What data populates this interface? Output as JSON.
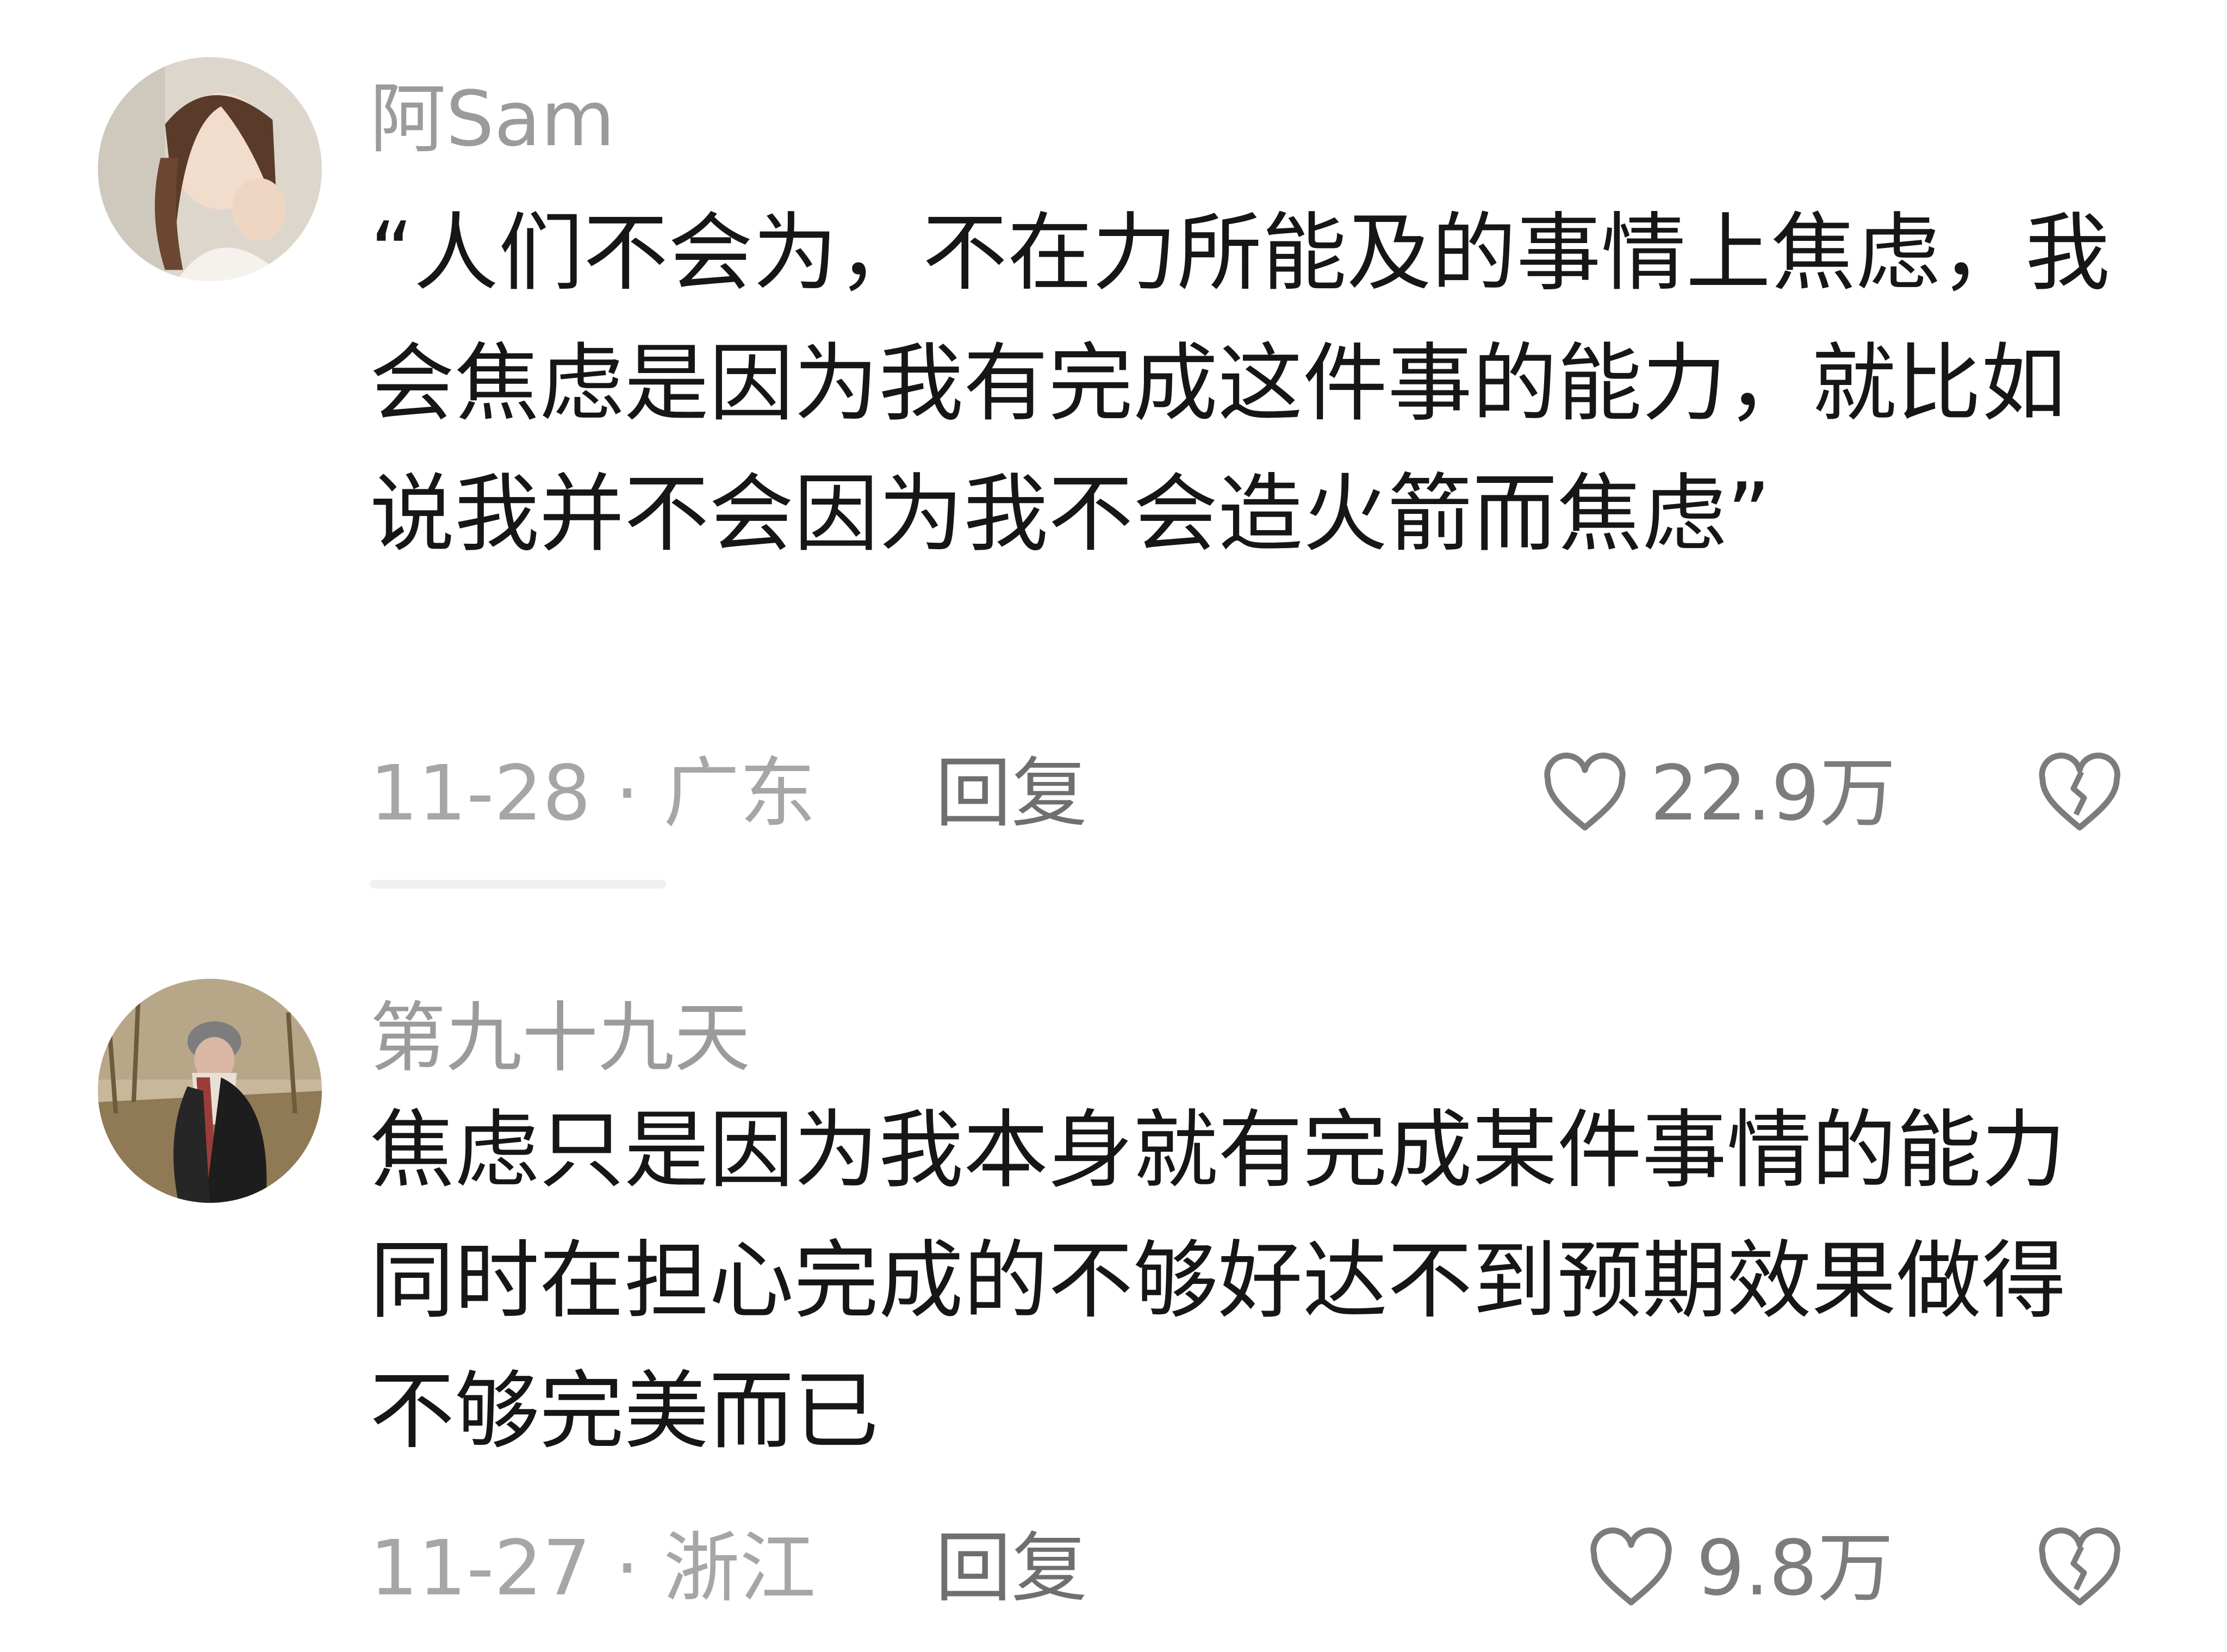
{
  "comments": [
    {
      "username": "阿Sam",
      "text": "“人们不会为，不在力所能及的事情上焦虑，我会焦虑是因为我有完成这件事的能力，就比如说我并不会因为我不会造火箭而焦虑”",
      "date_location": "11-28 · 广东",
      "reply_label": "回复",
      "likes": "22.9万"
    },
    {
      "username": "第九十九天",
      "text": "焦虑只是因为我本身就有完成某件事情的能力同时在担心完成的不够好达不到预期效果做得不够完美而已",
      "date_location": "11-27 · 浙江",
      "reply_label": "回复",
      "likes": "9.8万"
    }
  ],
  "icons": {
    "like": "heart-outline-icon",
    "dislike": "broken-heart-icon"
  },
  "colors": {
    "background": "#ffffff",
    "username": "#9b9b9b",
    "body_text": "#161616",
    "meta": "#a6a6a6"
  }
}
